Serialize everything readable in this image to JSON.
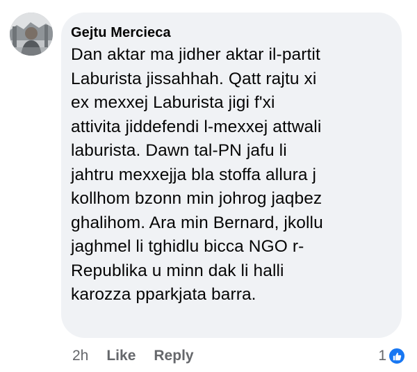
{
  "comment": {
    "author": "Gejtu Mercieca",
    "text": "Dan aktar ma jidher aktar il-partit\nLaburista jissahhah. Qatt rajtu xi\nex mexxej Laburista jigi f'xi\nattivita jiddefendi l-mexxej attwali\nlaburista. Dawn tal-PN jafu li\njahtru mexxejja bla stoffa allura j\nkollhom bzonn min johrog jaqbez\nghalihom. Ara min Bernard, jkollu\njaghmel li tghidlu bicca NGO r-\nRepublika u minn dak li halli\nkarozza pparkjata barra.",
    "time": "2h",
    "like_label": "Like",
    "reply_label": "Reply",
    "reaction_count": "1",
    "reaction_icon": "thumbs-up-icon",
    "reaction_color": "#1877f2"
  }
}
